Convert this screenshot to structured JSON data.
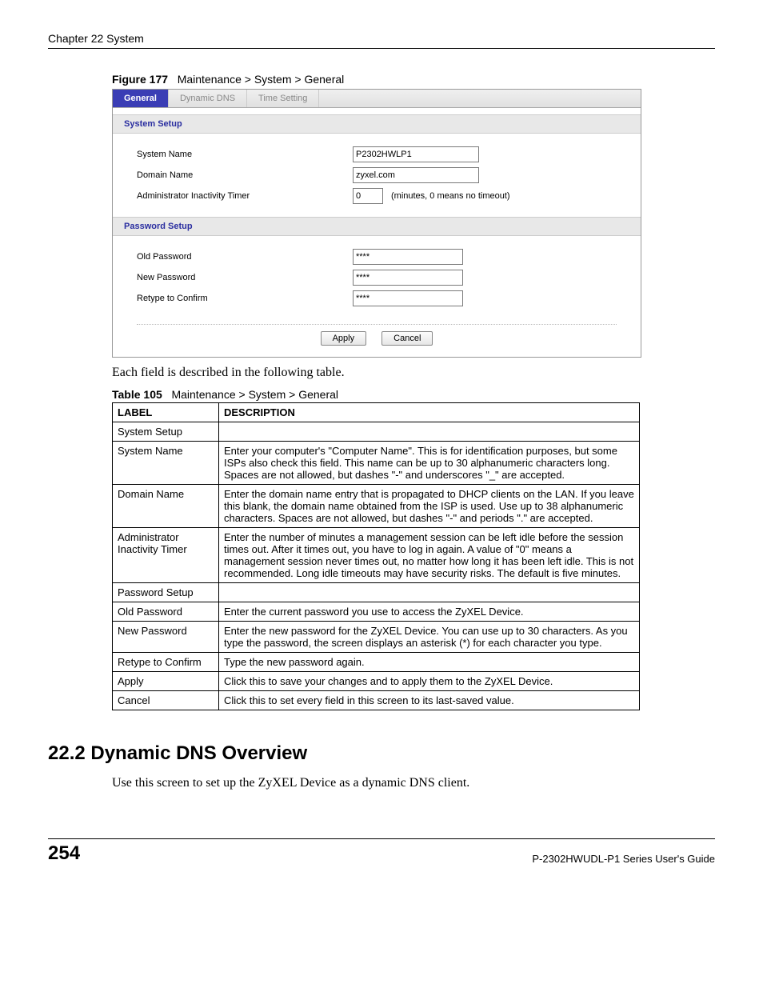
{
  "header": {
    "chapter": "Chapter 22 System"
  },
  "figure": {
    "label": "Figure 177",
    "caption": "Maintenance > System > General"
  },
  "screenshot": {
    "tabs": {
      "general": "General",
      "ddns": "Dynamic DNS",
      "time": "Time Setting"
    },
    "sections": {
      "system_setup": "System Setup",
      "password_setup": "Password Setup"
    },
    "labels": {
      "system_name": "System Name",
      "domain_name": "Domain Name",
      "admin_timer": "Administrator Inactivity Timer",
      "old_password": "Old Password",
      "new_password": "New Password",
      "retype": "Retype to Confirm"
    },
    "values": {
      "system_name": "P2302HWLP1",
      "domain_name": "zyxel.com",
      "admin_timer": "0",
      "old_password": "****",
      "new_password": "****",
      "retype": "****"
    },
    "hint": "(minutes, 0 means no timeout)",
    "buttons": {
      "apply": "Apply",
      "cancel": "Cancel"
    }
  },
  "intro_text": "Each field is described in the following table.",
  "table": {
    "label": "Table 105",
    "caption": "Maintenance > System > General",
    "headers": {
      "label": "LABEL",
      "description": "DESCRIPTION"
    },
    "rows": [
      {
        "label": "System Setup",
        "desc": ""
      },
      {
        "label": "System Name",
        "desc": "Enter your computer's  \"Computer Name\". This is for identification purposes, but some ISPs also check this field. This name can be up to 30 alphanumeric characters long. Spaces are not allowed, but dashes \"-\" and underscores \"_\" are accepted."
      },
      {
        "label": "Domain Name",
        "desc": "Enter the domain name entry that is propagated to DHCP clients on the LAN. If you leave this blank, the domain name obtained from the ISP is used. Use up to 38 alphanumeric characters. Spaces are not allowed, but dashes \"-\" and periods \".\" are accepted."
      },
      {
        "label": "Administrator Inactivity Timer",
        "desc": "Enter the number of minutes a management session can be left idle before the session times out. After it times out, you have to log in again. A value of \"0\" means a management session never times out, no matter how long it has been left idle. This is not recommended. Long idle timeouts may have security risks. The default is five minutes."
      },
      {
        "label": "Password Setup",
        "desc": ""
      },
      {
        "label": "Old Password",
        "desc": "Enter the current password you use to access the ZyXEL Device."
      },
      {
        "label": "New Password",
        "desc": "Enter the new password for the ZyXEL Device. You can use up to 30 characters. As you type the password, the screen displays an asterisk (*) for each character you type."
      },
      {
        "label": "Retype to Confirm",
        "desc": "Type the new password again."
      },
      {
        "label": "Apply",
        "desc": "Click this to save your changes and to apply them to the ZyXEL Device."
      },
      {
        "label": "Cancel",
        "desc": "Click this to set every field in this screen to its last-saved value."
      }
    ]
  },
  "section_22_2": {
    "title": "22.2  Dynamic DNS Overview",
    "text": "Use this screen to set up the ZyXEL Device as a dynamic DNS client."
  },
  "footer": {
    "page": "254",
    "guide": "P-2302HWUDL-P1 Series User's Guide"
  }
}
